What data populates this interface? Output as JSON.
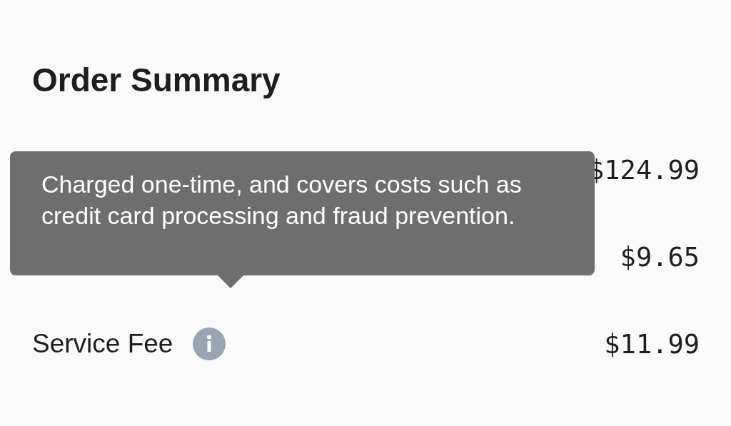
{
  "title": "Order Summary",
  "rows": [
    {
      "amount": "$124.99",
      "info": false
    },
    {
      "amount": "$9.65",
      "info": false
    },
    {
      "label": "Service Fee",
      "amount": "$11.99",
      "info": true
    }
  ],
  "tooltip": {
    "text": "Charged one-time, and covers costs such as credit card processing and fraud prevention."
  }
}
